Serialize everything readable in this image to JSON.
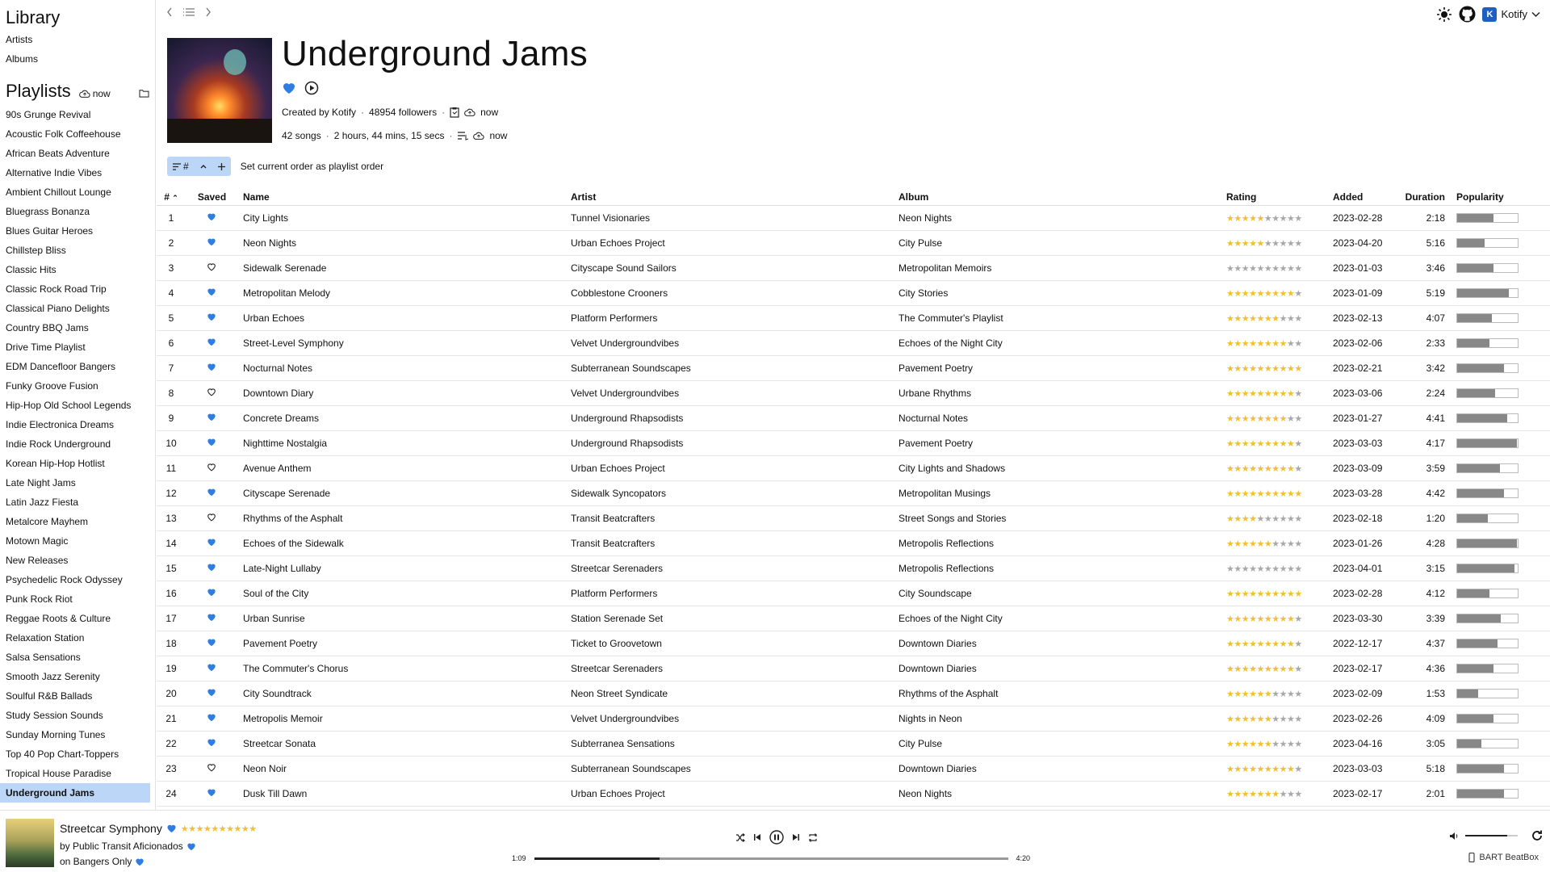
{
  "sidebar": {
    "library_title": "Library",
    "library_items": [
      {
        "label": "Artists"
      },
      {
        "label": "Albums"
      }
    ],
    "playlists_title": "Playlists",
    "sync_label": "now",
    "playlists": [
      {
        "label": "90s Grunge Revival"
      },
      {
        "label": "Acoustic Folk Coffeehouse"
      },
      {
        "label": "African Beats Adventure"
      },
      {
        "label": "Alternative Indie Vibes"
      },
      {
        "label": "Ambient Chillout Lounge"
      },
      {
        "label": "Bluegrass Bonanza"
      },
      {
        "label": "Blues Guitar Heroes"
      },
      {
        "label": "Chillstep Bliss"
      },
      {
        "label": "Classic Hits"
      },
      {
        "label": "Classic Rock Road Trip"
      },
      {
        "label": "Classical Piano Delights"
      },
      {
        "label": "Country BBQ Jams"
      },
      {
        "label": "Drive Time Playlist"
      },
      {
        "label": "EDM Dancefloor Bangers"
      },
      {
        "label": "Funky Groove Fusion"
      },
      {
        "label": "Hip-Hop Old School Legends"
      },
      {
        "label": "Indie Electronica Dreams"
      },
      {
        "label": "Indie Rock Underground"
      },
      {
        "label": "Korean Hip-Hop Hotlist"
      },
      {
        "label": "Late Night Jams"
      },
      {
        "label": "Latin Jazz Fiesta"
      },
      {
        "label": "Metalcore Mayhem"
      },
      {
        "label": "Motown Magic"
      },
      {
        "label": "New Releases"
      },
      {
        "label": "Psychedelic Rock Odyssey"
      },
      {
        "label": "Punk Rock Riot"
      },
      {
        "label": "Reggae Roots & Culture"
      },
      {
        "label": "Relaxation Station"
      },
      {
        "label": "Salsa Sensations"
      },
      {
        "label": "Smooth Jazz Serenity"
      },
      {
        "label": "Soulful R&B Ballads"
      },
      {
        "label": "Study Session Sounds"
      },
      {
        "label": "Sunday Morning Tunes"
      },
      {
        "label": "Top 40 Pop Chart-Toppers"
      },
      {
        "label": "Tropical House Paradise"
      },
      {
        "label": "Underground Jams",
        "active": true
      }
    ]
  },
  "header": {
    "user_name": "Kotify",
    "user_initial": "K"
  },
  "playlist": {
    "title": "Underground Jams",
    "created_by": "Created by Kotify",
    "followers": "48954 followers",
    "meta_sync1": "now",
    "song_count": "42 songs",
    "duration": "2 hours, 44 mins, 15 secs",
    "meta_sync2": "now",
    "toolbar_sort_label": "#",
    "set_order_label": "Set current order as playlist order"
  },
  "table": {
    "columns": {
      "num": "#",
      "saved": "Saved",
      "name": "Name",
      "artist": "Artist",
      "album": "Album",
      "rating": "Rating",
      "added": "Added",
      "duration": "Duration",
      "popularity": "Popularity"
    },
    "rows": [
      {
        "num": "1",
        "saved": true,
        "name": "City Lights",
        "artist": "Tunnel Visionaries",
        "album": "Neon Nights",
        "rating": 5,
        "added": "2023-02-28",
        "duration": "2:18",
        "popularity": 0.6
      },
      {
        "num": "2",
        "saved": true,
        "name": "Neon Nights",
        "artist": "Urban Echoes Project",
        "album": "City Pulse",
        "rating": 5,
        "added": "2023-04-20",
        "duration": "5:16",
        "popularity": 0.45
      },
      {
        "num": "3",
        "saved": false,
        "name": "Sidewalk Serenade",
        "artist": "Cityscape Sound Sailors",
        "album": "Metropolitan Memoirs",
        "rating": 0,
        "added": "2023-01-03",
        "duration": "3:46",
        "popularity": 0.6
      },
      {
        "num": "4",
        "saved": true,
        "name": "Metropolitan Melody",
        "artist": "Cobblestone Crooners",
        "album": "City Stories",
        "rating": 9,
        "added": "2023-01-09",
        "duration": "5:19",
        "popularity": 0.85
      },
      {
        "num": "5",
        "saved": true,
        "name": "Urban Echoes",
        "artist": "Platform Performers",
        "album": "The Commuter's Playlist",
        "rating": 7,
        "added": "2023-02-13",
        "duration": "4:07",
        "popularity": 0.57
      },
      {
        "num": "6",
        "saved": true,
        "name": "Street-Level Symphony",
        "artist": "Velvet Undergroundvibes",
        "album": "Echoes of the Night City",
        "rating": 8,
        "added": "2023-02-06",
        "duration": "2:33",
        "popularity": 0.53
      },
      {
        "num": "7",
        "saved": true,
        "name": "Nocturnal Notes",
        "artist": "Subterranean Soundscapes",
        "album": "Pavement Poetry",
        "rating": 10,
        "added": "2023-02-21",
        "duration": "3:42",
        "popularity": 0.77
      },
      {
        "num": "8",
        "saved": false,
        "name": "Downtown Diary",
        "artist": "Velvet Undergroundvibes",
        "album": "Urbane Rhythms",
        "rating": 9,
        "added": "2023-03-06",
        "duration": "2:24",
        "popularity": 0.62
      },
      {
        "num": "9",
        "saved": true,
        "name": "Concrete Dreams",
        "artist": "Underground Rhapsodists",
        "album": "Nocturnal Notes",
        "rating": 8,
        "added": "2023-01-27",
        "duration": "4:41",
        "popularity": 0.82
      },
      {
        "num": "10",
        "saved": true,
        "name": "Nighttime Nostalgia",
        "artist": "Underground Rhapsodists",
        "album": "Pavement Poetry",
        "rating": 9,
        "added": "2023-03-03",
        "duration": "4:17",
        "popularity": 0.98
      },
      {
        "num": "11",
        "saved": false,
        "name": "Avenue Anthem",
        "artist": "Urban Echoes Project",
        "album": "City Lights and Shadows",
        "rating": 9,
        "added": "2023-03-09",
        "duration": "3:59",
        "popularity": 0.7
      },
      {
        "num": "12",
        "saved": true,
        "name": "Cityscape Serenade",
        "artist": "Sidewalk Syncopators",
        "album": "Metropolitan Musings",
        "rating": 10,
        "added": "2023-03-28",
        "duration": "4:42",
        "popularity": 0.77
      },
      {
        "num": "13",
        "saved": false,
        "name": "Rhythms of the Asphalt",
        "artist": "Transit Beatcrafters",
        "album": "Street Songs and Stories",
        "rating": 4,
        "added": "2023-02-18",
        "duration": "1:20",
        "popularity": 0.5
      },
      {
        "num": "14",
        "saved": true,
        "name": "Echoes of the Sidewalk",
        "artist": "Transit Beatcrafters",
        "album": "Metropolis Reflections",
        "rating": 6,
        "added": "2023-01-26",
        "duration": "4:28",
        "popularity": 0.98
      },
      {
        "num": "15",
        "saved": true,
        "name": "Late-Night Lullaby",
        "artist": "Streetcar Serenaders",
        "album": "Metropolis Reflections",
        "rating": 0,
        "added": "2023-04-01",
        "duration": "3:15",
        "popularity": 0.95
      },
      {
        "num": "16",
        "saved": true,
        "name": "Soul of the City",
        "artist": "Platform Performers",
        "album": "City Soundscape",
        "rating": 10,
        "added": "2023-02-28",
        "duration": "4:12",
        "popularity": 0.53
      },
      {
        "num": "17",
        "saved": true,
        "name": "Urban Sunrise",
        "artist": "Station Serenade Set",
        "album": "Echoes of the Night City",
        "rating": 9,
        "added": "2023-03-30",
        "duration": "3:39",
        "popularity": 0.72
      },
      {
        "num": "18",
        "saved": true,
        "name": "Pavement Poetry",
        "artist": "Ticket to Groovetown",
        "album": "Downtown Diaries",
        "rating": 9,
        "added": "2022-12-17",
        "duration": "4:37",
        "popularity": 0.67
      },
      {
        "num": "19",
        "saved": true,
        "name": "The Commuter's Chorus",
        "artist": "Streetcar Serenaders",
        "album": "Downtown Diaries",
        "rating": 9,
        "added": "2023-02-17",
        "duration": "4:36",
        "popularity": 0.6
      },
      {
        "num": "20",
        "saved": true,
        "name": "City Soundtrack",
        "artist": "Neon Street Syndicate",
        "album": "Rhythms of the Asphalt",
        "rating": 6,
        "added": "2023-02-09",
        "duration": "1:53",
        "popularity": 0.35
      },
      {
        "num": "21",
        "saved": true,
        "name": "Metropolis Memoir",
        "artist": "Velvet Undergroundvibes",
        "album": "Nights in Neon",
        "rating": 6,
        "added": "2023-02-26",
        "duration": "4:09",
        "popularity": 0.6
      },
      {
        "num": "22",
        "saved": true,
        "name": "Streetcar Sonata",
        "artist": "Subterranea Sensations",
        "album": "City Pulse",
        "rating": 6,
        "added": "2023-04-16",
        "duration": "3:05",
        "popularity": 0.4
      },
      {
        "num": "23",
        "saved": false,
        "name": "Neon Noir",
        "artist": "Subterranean Soundscapes",
        "album": "Downtown Diaries",
        "rating": 9,
        "added": "2023-03-03",
        "duration": "5:18",
        "popularity": 0.77
      },
      {
        "num": "24",
        "saved": true,
        "name": "Dusk Till Dawn",
        "artist": "Urban Echoes Project",
        "album": "Neon Nights",
        "rating": 7,
        "added": "2023-02-17",
        "duration": "2:01",
        "popularity": 0.77
      }
    ]
  },
  "player": {
    "track": "Streetcar Symphony",
    "track_rating": 10,
    "artist_line": "by Public Transit Aficionados",
    "album_line": "on Bangers Only",
    "elapsed": "1:09",
    "total": "4:20",
    "progress": 0.265,
    "volume": 0.8,
    "device": "BART BeatBox"
  },
  "colors": {
    "accent": "#2f7de1",
    "selection": "#bcd6f7",
    "star_on": "#f0c030",
    "star_off": "#a8a8a8"
  },
  "icons": [
    "back-icon",
    "list-icon",
    "forward-icon",
    "sun-icon",
    "github-icon",
    "chevron-down-icon",
    "cloud-icon",
    "folder-icon",
    "heart-icon",
    "play-circle-icon",
    "sort-icon",
    "caret-up-icon",
    "plus-icon",
    "shuffle-icon",
    "previous-icon",
    "pause-icon",
    "next-icon",
    "repeat-icon",
    "volume-icon",
    "refresh-icon",
    "phone-icon"
  ]
}
